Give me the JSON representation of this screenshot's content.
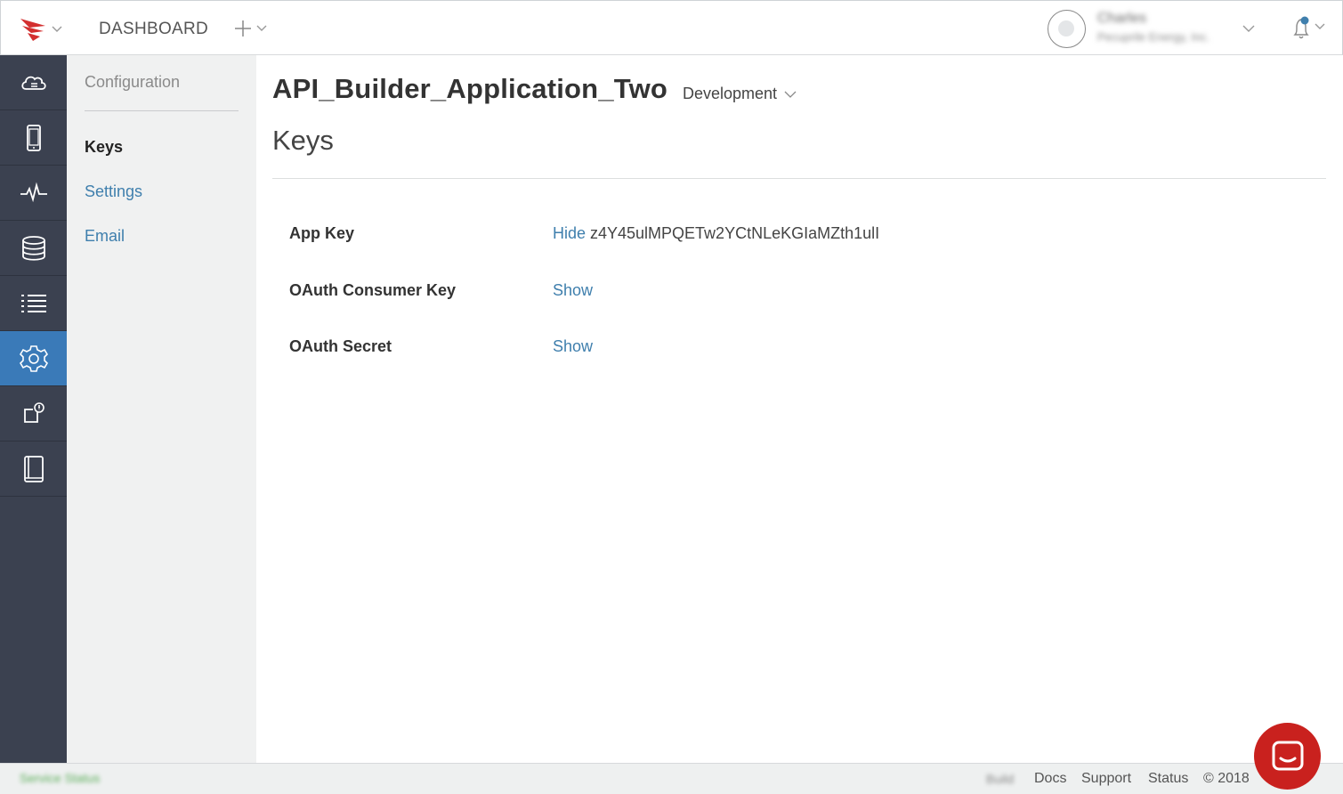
{
  "topbar": {
    "dashboard_label": "DASHBOARD",
    "user_name": "Charles",
    "user_org": "Pecuprile Energy, Inc."
  },
  "subnav": {
    "heading": "Configuration",
    "items": [
      {
        "label": "Keys",
        "active": true
      },
      {
        "label": "Settings",
        "active": false
      },
      {
        "label": "Email",
        "active": false
      }
    ]
  },
  "main": {
    "app_title": "API_Builder_Application_Two",
    "environment": "Development",
    "section_title": "Keys",
    "keys": [
      {
        "label": "App Key",
        "action": "Hide",
        "value": "z4Y45ulMPQETw2YCtNLeKGIaMZth1ulI"
      },
      {
        "label": "OAuth Consumer Key",
        "action": "Show"
      },
      {
        "label": "OAuth Secret",
        "action": "Show"
      }
    ]
  },
  "footer": {
    "status_text": "Service Status",
    "blurred_link": "Build",
    "docs": "Docs",
    "support": "Support",
    "status": "Status",
    "copyright": "© 2018"
  },
  "colors": {
    "rail_bg": "#3b4150",
    "rail_active": "#3a7ab8",
    "link": "#3f7fad",
    "brand": "#c9211e"
  },
  "icons": {
    "rail": [
      "cloud-api-icon",
      "mobile-device-icon",
      "analytics-pulse-icon",
      "database-icon",
      "list-icon",
      "gear-icon",
      "alert-box-icon",
      "book-icon"
    ],
    "active_rail_index": 5
  }
}
